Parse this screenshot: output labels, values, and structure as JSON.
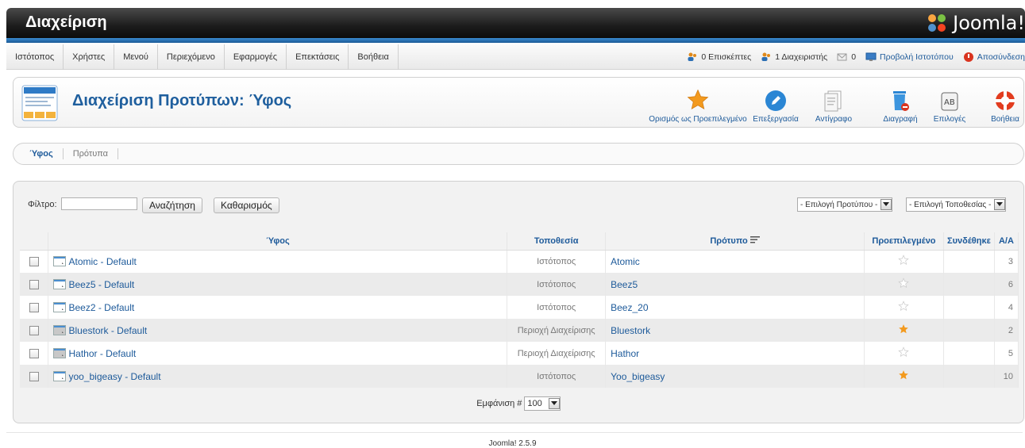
{
  "header": {
    "title": "Διαχείριση",
    "logo_text": "Joomla!"
  },
  "menu": {
    "items": [
      "Ιστότοπος",
      "Χρήστες",
      "Μενού",
      "Περιεχόμενο",
      "Εφαρμογές",
      "Επεκτάσεις",
      "Βοήθεια"
    ]
  },
  "status": {
    "visitors": "0 Επισκέπτες",
    "admins": "1 Διαχειριστής",
    "messages": "0",
    "view_site": "Προβολή Ιστοτόπου",
    "logout": "Αποσύνδεση"
  },
  "toolbar": {
    "page_title": "Διαχείριση Προτύπων: Ύφος",
    "make_default": "Ορισμός ως Προεπιλεγμένο",
    "edit": "Επεξεργασία",
    "copy": "Αντίγραφο",
    "delete": "Διαγραφή",
    "options": "Επιλογές",
    "help": "Βοήθεια"
  },
  "subtabs": [
    "Ύφος",
    "Πρότυπα"
  ],
  "filter": {
    "label": "Φίλτρο:",
    "value": "",
    "search_button": "Αναζήτηση",
    "clear_button": "Καθαρισμός",
    "template_select": "- Επιλογή Προτύπου -",
    "position_select": "- Επιλογή Τοποθεσίας -"
  },
  "table": {
    "headers": {
      "style": "Ύφος",
      "location": "Τοποθεσία",
      "template": "Πρότυπο",
      "default": "Προεπιλεγμένο",
      "assigned": "Συνδέθηκε",
      "id": "Α/Α"
    },
    "rows": [
      {
        "style": "Atomic - Default",
        "location": "Ιστότοπος",
        "template": "Atomic",
        "default": false,
        "id": "3"
      },
      {
        "style": "Beez5 - Default",
        "location": "Ιστότοπος",
        "template": "Beez5",
        "default": false,
        "id": "6"
      },
      {
        "style": "Beez2 - Default",
        "location": "Ιστότοπος",
        "template": "Beez_20",
        "default": false,
        "id": "4"
      },
      {
        "style": "Bluestork - Default",
        "location": "Περιοχή Διαχείρισης",
        "template": "Bluestork",
        "default": true,
        "id": "2"
      },
      {
        "style": "Hathor - Default",
        "location": "Περιοχή Διαχείρισης",
        "template": "Hathor",
        "default": false,
        "id": "5"
      },
      {
        "style": "yoo_bigeasy - Default",
        "location": "Ιστότοπος",
        "template": "Yoo_bigeasy",
        "default": true,
        "id": "10"
      }
    ]
  },
  "pager": {
    "label": "Εμφάνιση #",
    "value": "100"
  },
  "footer": {
    "version": "Joomla! 2.5.9"
  },
  "colors": {
    "link": "#1d5a9a",
    "header_bg": "#1c1c1c",
    "accent_blue": "#2a78c0",
    "star_active": "#f39a1e"
  }
}
